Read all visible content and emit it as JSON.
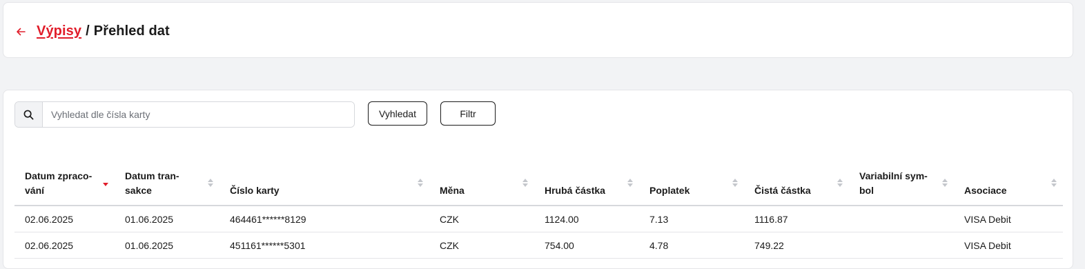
{
  "header": {
    "breadcrumb_link": "Výpisy",
    "breadcrumb_separator": "/",
    "breadcrumb_current": "Přehled dat"
  },
  "search": {
    "placeholder": "Vyhledat dle čísla karty",
    "value": ""
  },
  "buttons": {
    "search_label": "Vyhledat",
    "filter_label": "Filtr"
  },
  "colors": {
    "accent": "#e11d2a",
    "background": "#f2f3f5",
    "sort_inactive": "#c4c7cc"
  },
  "table": {
    "columns": [
      {
        "label": "Datum zpraco-vání",
        "line1": "Datum zpraco-",
        "line2": "vání",
        "sort": "descending"
      },
      {
        "label": "Datum tran-sakce",
        "line1": "Datum tran-",
        "line2": "sakce",
        "sort": "none"
      },
      {
        "label": "Číslo karty",
        "line1": "",
        "line2": "Číslo karty",
        "sort": "none"
      },
      {
        "label": "Měna",
        "line1": "",
        "line2": "Měna",
        "sort": "none"
      },
      {
        "label": "Hrubá částka",
        "line1": "",
        "line2": "Hrubá částka",
        "sort": "none"
      },
      {
        "label": "Poplatek",
        "line1": "",
        "line2": "Poplatek",
        "sort": "none"
      },
      {
        "label": "Čistá částka",
        "line1": "",
        "line2": "Čistá částka",
        "sort": "none"
      },
      {
        "label": "Variabilní sym-bol",
        "line1": "Variabilní sym-",
        "line2": "bol",
        "sort": "none"
      },
      {
        "label": "Asociace",
        "line1": "",
        "line2": "Asociace",
        "sort": "none"
      }
    ],
    "rows": [
      [
        "02.06.2025",
        "01.06.2025",
        "464461******8129",
        "CZK",
        "1124.00",
        "7.13",
        "1116.87",
        "",
        "VISA Debit"
      ],
      [
        "02.06.2025",
        "01.06.2025",
        "451161******5301",
        "CZK",
        "754.00",
        "4.78",
        "749.22",
        "",
        "VISA Debit"
      ]
    ]
  }
}
